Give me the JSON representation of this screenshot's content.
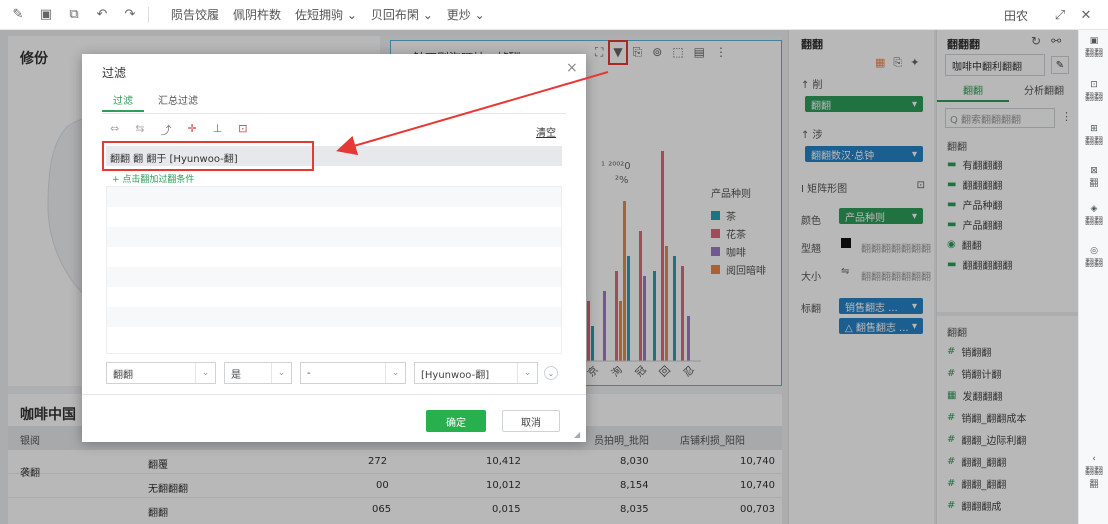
{
  "topbar": {
    "menus": [
      "陨告饺履",
      "佩阴杵数",
      "佐短拥驹 ⌄",
      "贝回布閑 ⌄",
      "更炒 ⌄"
    ],
    "right_label": "田农"
  },
  "dashboard": {
    "card1_title": "修份",
    "card2_title": "咖啡中国",
    "chart_title": "针丁则沟叮灿...帧酬",
    "chart_annotation_1": "¹ ²⁰⁰²0",
    "chart_annotation_2": "²%",
    "legend_title": "产品种则",
    "legend_items": [
      {
        "label": "茶",
        "color": "#2a9fb5"
      },
      {
        "label": "花茶",
        "color": "#e0697f"
      },
      {
        "label": "咖啡",
        "color": "#9c7bc9"
      },
      {
        "label": "阅回暗啡",
        "color": "#e98a4a"
      }
    ],
    "x_ticks": [
      "京",
      "洵",
      "冠",
      "回",
      "忍"
    ],
    "table_headers": [
      "银阅",
      "",
      "",
      "",
      "员拍明_批阳",
      "店铺利损_阳阳"
    ],
    "table_rows": [
      {
        "group": "袭翻",
        "name": "翻覆",
        "v1": "272",
        "v2": "10,412",
        "v3": "8,030",
        "v4": "10,740"
      },
      {
        "group": "",
        "name": "无翻翻翻",
        "v1": "00",
        "v2": "10,012",
        "v3": "8,154",
        "v4": "10,740"
      },
      {
        "group": "",
        "name": "翻翻",
        "v1": "065",
        "v2": "0,015",
        "v3": "8,035",
        "v4": "00,703"
      }
    ]
  },
  "config_panel": {
    "title": "翻翻",
    "x_axis_label": "↑ 削",
    "x_axis_field": "翻翻",
    "y_axis_label": "↑ 涉",
    "y_axis_field": "翻翻数汉·总钟",
    "chart_type_label": "Ⅰ 矩阵形图",
    "color_label": "颜色",
    "color_field": "产品种则",
    "border_label": "型翘",
    "border_value": "翻翻翻翻翻翻翻",
    "size_label": "大小",
    "size_value": "翻翻翻翻翻翻翻",
    "label_label": "标翻",
    "label_field1": "销售翻志 ...",
    "label_field2": "△ 翻售翻志 ..."
  },
  "data_panel": {
    "title": "翻翻翻",
    "dataset_select": "咖啡中翻利翻翻",
    "tab_data": "翻翻",
    "tab_analysis": "分析翻翻",
    "search_placeholder": "Q 翻索翻翻翻翻",
    "dim_section": "翻翻",
    "dims": [
      "有翻翻翻",
      "翻翻翻翻",
      "产品种翻",
      "产品翻翻",
      "翻翻",
      "翻翻翻翻翻"
    ],
    "measure_section": "翻翻",
    "measures": [
      "销翻翻",
      "销翻计翻",
      "发翻翻翻",
      "销翻_翻翻成本",
      "翻翻_边际利翻",
      "翻翻_翻翻",
      "翻翻_翻翻",
      "翻翻翻成"
    ]
  },
  "rail": {
    "items": [
      "翻翻",
      "翻翻",
      "翻翻",
      "翻",
      "翻翻",
      "翻翻",
      "翻翻翻"
    ]
  },
  "filter_dialog": {
    "title": "过滤",
    "close": "×",
    "tab_filter": "过滤",
    "tab_summary_filter": "汇总过滤",
    "clear_label": "清空",
    "condition": "翻翻 翻 翻于 [Hyunwoo-翻]",
    "add_condition": "+ 点击翻加过翻条件",
    "field_select": "翻翻",
    "op_select": "是",
    "mode_select": "-",
    "value_select": "[Hyunwoo-翻]",
    "ok_button": "确定",
    "cancel_button": "取消"
  }
}
